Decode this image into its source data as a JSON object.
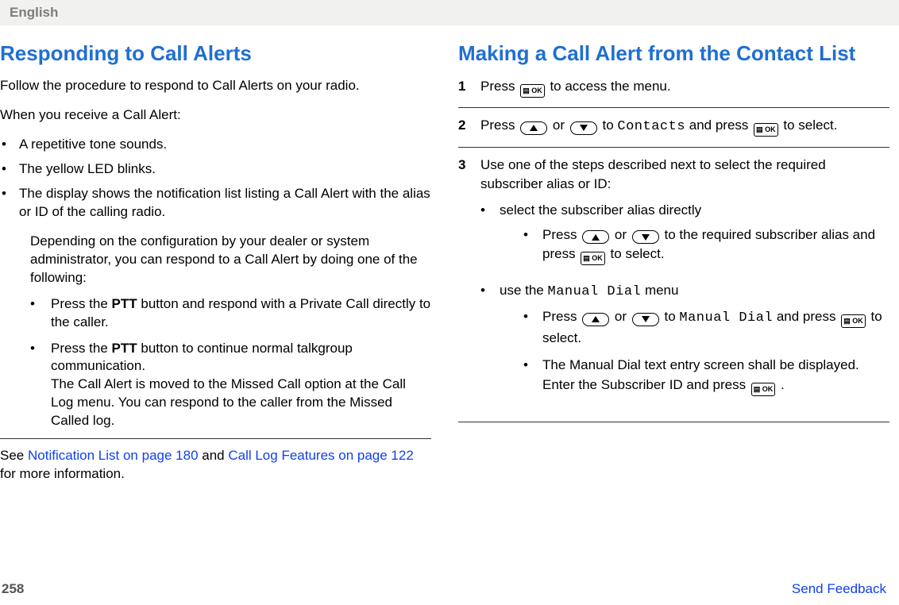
{
  "header": {
    "language": "English"
  },
  "left": {
    "title": "Responding to Call Alerts",
    "intro": "Follow the procedure to respond to Call Alerts on your radio.",
    "when": "When you receive a Call Alert:",
    "bullets": [
      "A repetitive tone sounds.",
      "The yellow LED blinks.",
      "The display shows the notification list listing a Call Alert with the alias or ID of the calling radio."
    ],
    "depend": "Depending on the configuration by your dealer or system administrator, you can respond to a Call Alert by doing one of the following:",
    "sub": {
      "a_pre": "Press the ",
      "a_bold": "PTT",
      "a_post": " button and respond with a Private Call directly to the caller.",
      "b_pre": "Press the ",
      "b_bold": "PTT",
      "b_post1": " button to continue normal talkgroup communication.",
      "b_post2": "The Call Alert is moved to the Missed Call option at the Call Log menu. You can respond to the caller from the Missed Called log."
    },
    "see_pre": "See ",
    "see_link1": "Notification List on page 180",
    "see_mid": " and ",
    "see_link2": "Call Log Features on page 122",
    "see_post": " for more information."
  },
  "right": {
    "title": "Making a Call Alert from the Contact List",
    "steps": {
      "s1": {
        "num": "1",
        "pre": "Press ",
        "post": " to access the menu."
      },
      "s2": {
        "num": "2",
        "pre": "Press ",
        "mid1": " or ",
        "mid2": " to ",
        "contacts": "Contacts",
        "mid3": " and press ",
        "post": " to select."
      },
      "s3": {
        "num": "3",
        "intro": "Use one of the steps described next to select the required subscriber alias or ID:",
        "opt1": "select the subscriber alias directly",
        "opt1_sub_pre": "Press ",
        "opt1_sub_mid1": " or ",
        "opt1_sub_mid2": " to the required subscriber alias and press ",
        "opt1_sub_post": " to select.",
        "opt2_pre": "use the ",
        "opt2_mono": "Manual Dial",
        "opt2_post": " menu",
        "opt2_sub1_pre": "Press ",
        "opt2_sub1_mid1": " or ",
        "opt2_sub1_mid2": " to ",
        "opt2_sub1_mono": "Manual Dial",
        "opt2_sub1_mid3": " and press ",
        "opt2_sub1_post": " to select.",
        "opt2_sub2_pre": "The Manual Dial text entry screen shall be displayed. Enter the Subscriber ID and press ",
        "opt2_sub2_post": " ."
      }
    }
  },
  "footer": {
    "page": "258",
    "feedback": "Send Feedback"
  },
  "icons": {
    "ok": "▤ OK"
  }
}
